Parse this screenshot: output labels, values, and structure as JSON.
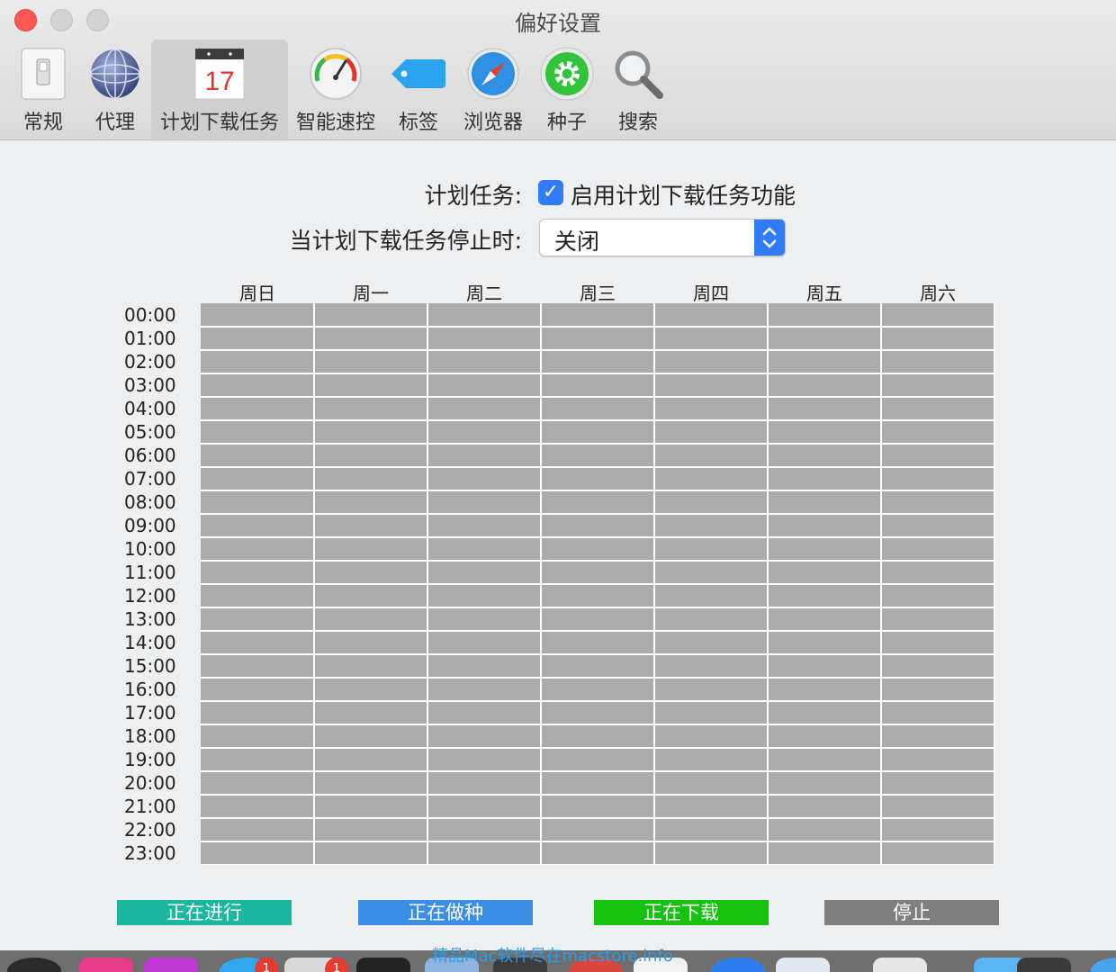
{
  "window": {
    "title": "偏好设置"
  },
  "toolbar": {
    "items": [
      {
        "label": "常规",
        "icon": "switch-icon"
      },
      {
        "label": "代理",
        "icon": "globe-icon"
      },
      {
        "label": "计划下载任务",
        "icon": "calendar-icon",
        "calendar_day": "17",
        "selected": true
      },
      {
        "label": "智能速控",
        "icon": "speedometer-icon"
      },
      {
        "label": "标签",
        "icon": "tag-icon"
      },
      {
        "label": "浏览器",
        "icon": "compass-icon"
      },
      {
        "label": "种子",
        "icon": "gear-icon"
      },
      {
        "label": "搜索",
        "icon": "magnifier-icon"
      }
    ]
  },
  "schedule": {
    "task_label": "计划任务:",
    "enable_label": "启用计划下载任务功能",
    "enabled": true,
    "stop_label": "当计划下载任务停止时:",
    "stop_action": "关闭",
    "days": [
      "周日",
      "周一",
      "周二",
      "周三",
      "周四",
      "周五",
      "周六"
    ],
    "hours": [
      "00:00",
      "01:00",
      "02:00",
      "03:00",
      "04:00",
      "05:00",
      "06:00",
      "07:00",
      "08:00",
      "09:00",
      "10:00",
      "11:00",
      "12:00",
      "13:00",
      "14:00",
      "15:00",
      "16:00",
      "17:00",
      "18:00",
      "19:00",
      "20:00",
      "21:00",
      "22:00",
      "23:00"
    ],
    "cell_state": "停止"
  },
  "legend": [
    {
      "label": "正在进行",
      "color": "#1bb7a0"
    },
    {
      "label": "正在做种",
      "color": "#3b8ee6"
    },
    {
      "label": "正在下载",
      "color": "#15c210"
    },
    {
      "label": "停止",
      "color": "#7f7f7f"
    }
  ],
  "colors": {
    "accent": "#2f7cf6",
    "cell_off": "#acacac",
    "close_button": "#fc5753"
  },
  "dock": {
    "watermark": "精品Mac软件尽在macstore.info",
    "badges": [
      "1",
      "1"
    ]
  }
}
